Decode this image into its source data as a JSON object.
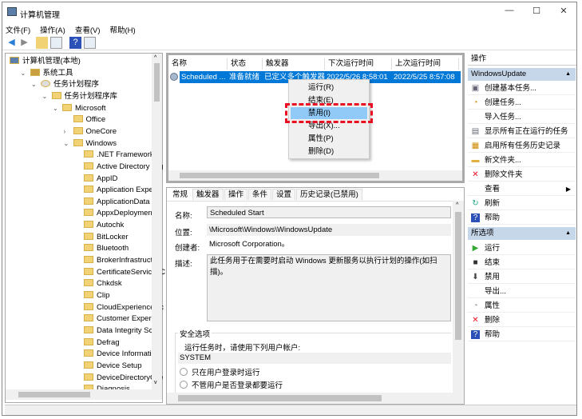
{
  "window": {
    "title": "计算机管理",
    "controls": [
      "—",
      "☐",
      "✕"
    ]
  },
  "menu": [
    "文件(F)",
    "操作(A)",
    "查看(V)",
    "帮助(H)"
  ],
  "tree": [
    {
      "label": "计算机管理(本地)",
      "level": 0
    },
    {
      "label": "系统工具",
      "level": 1,
      "expanded": true
    },
    {
      "label": "任务计划程序",
      "level": 2,
      "expanded": true
    },
    {
      "label": "任务计划程序库",
      "level": 3,
      "expanded": true
    },
    {
      "label": "Microsoft",
      "level": 4,
      "expanded": true
    },
    {
      "label": "Office",
      "level": 5
    },
    {
      "label": "OneCore",
      "level": 5,
      "collapsed": true
    },
    {
      "label": "Windows",
      "level": 5,
      "expanded": true
    },
    {
      "label": ".NET Framework",
      "level": 6
    },
    {
      "label": "Active Directory Rig",
      "level": 6
    },
    {
      "label": "AppID",
      "level": 6
    },
    {
      "label": "Application Experie",
      "level": 6
    },
    {
      "label": "ApplicationData",
      "level": 6
    },
    {
      "label": "AppxDeploymentCl",
      "level": 6
    },
    {
      "label": "Autochk",
      "level": 6
    },
    {
      "label": "BitLocker",
      "level": 6
    },
    {
      "label": "Bluetooth",
      "level": 6
    },
    {
      "label": "BrokerInfrastructur",
      "level": 6
    },
    {
      "label": "CertificateServicesC",
      "level": 6
    },
    {
      "label": "Chkdsk",
      "level": 6
    },
    {
      "label": "Clip",
      "level": 6
    },
    {
      "label": "CloudExperienceHc",
      "level": 6
    },
    {
      "label": "Customer Experien",
      "level": 6
    },
    {
      "label": "Data Integrity Scan",
      "level": 6
    },
    {
      "label": "Defrag",
      "level": 6
    },
    {
      "label": "Device Information",
      "level": 6
    },
    {
      "label": "Device Setup",
      "level": 6
    },
    {
      "label": "DeviceDirectoryClie",
      "level": 6
    },
    {
      "label": "Diagnosis",
      "level": 6
    }
  ],
  "tasks": {
    "columns": [
      "名称",
      "状态",
      "触发器",
      "下次运行时间",
      "上次运行时间"
    ],
    "rows": [
      {
        "name": "Scheduled ...",
        "status": "准备就绪",
        "trigger": "已定义多个触发器",
        "next": "2022/5/26 8:58:01",
        "last": "2022/5/25 8:57:08"
      }
    ]
  },
  "context_menu": {
    "items": [
      "运行(R)",
      "结束(E)",
      "禁用(I)",
      "导出(X)...",
      "属性(P)",
      "删除(D)"
    ],
    "highlighted": "禁用(I)",
    "highlight_color": "#e81123"
  },
  "details": {
    "tabs": [
      "常规",
      "触发器",
      "操作",
      "条件",
      "设置",
      "历史记录(已禁用)"
    ],
    "active_tab": "常规",
    "name_label": "名称:",
    "name": "Scheduled Start",
    "location_label": "位置:",
    "location": "\\Microsoft\\Windows\\WindowsUpdate",
    "author_label": "创建者:",
    "author": "Microsoft Corporation。",
    "desc_label": "描述:",
    "description": "此任务用于在需要时启动 Windows 更新服务以执行计划的操作(如扫描)。",
    "security_title": "安全选项",
    "run_as_label": "运行任务时，请使用下列用户帐户:",
    "account": "SYSTEM",
    "radio1": "只在用户登录时运行",
    "radio2": "不管用户是否登录都要运行"
  },
  "actions": {
    "title": "操作",
    "section1": "WindowsUpdate",
    "items1": [
      {
        "label": "创建基本任务...",
        "icon": "create-basic-task-icon"
      },
      {
        "label": "创建任务...",
        "icon": "create-task-icon"
      },
      {
        "label": "导入任务...",
        "icon": ""
      },
      {
        "label": "显示所有正在运行的任务",
        "icon": "running-tasks-icon"
      },
      {
        "label": "启用所有任务历史记录",
        "icon": "history-icon"
      },
      {
        "label": "新文件夹...",
        "icon": "folder-icon"
      },
      {
        "label": "删除文件夹",
        "icon": "delete-icon"
      },
      {
        "label": "查看",
        "icon": "",
        "submenu": true
      },
      {
        "label": "刷新",
        "icon": "refresh-icon"
      },
      {
        "label": "帮助",
        "icon": "help-icon"
      }
    ],
    "section2": "所选项",
    "items2": [
      {
        "label": "运行",
        "icon": "run-icon"
      },
      {
        "label": "结束",
        "icon": "stop-icon"
      },
      {
        "label": "禁用",
        "icon": "disable-icon"
      },
      {
        "label": "导出...",
        "icon": ""
      },
      {
        "label": "属性",
        "icon": "properties-icon"
      },
      {
        "label": "删除",
        "icon": "delete-icon"
      },
      {
        "label": "帮助",
        "icon": "help-icon"
      }
    ]
  }
}
